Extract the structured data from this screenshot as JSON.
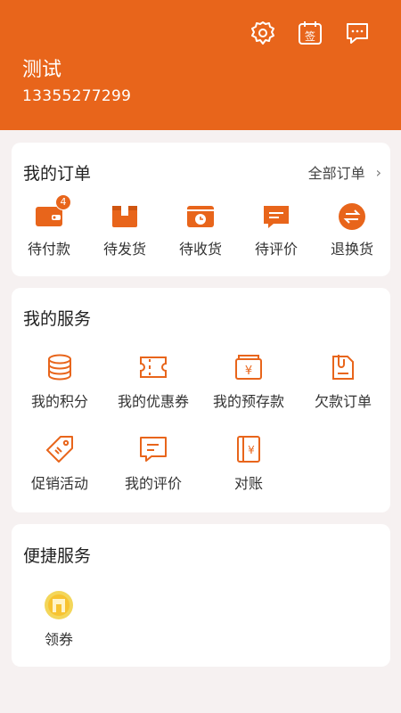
{
  "header": {
    "user_name": "测试",
    "phone": "13355277299",
    "icons": [
      "gear-icon",
      "sign-in-icon",
      "message-icon"
    ],
    "accent": "#e8651b"
  },
  "orders": {
    "title": "我的订单",
    "all_label": "全部订单",
    "items": [
      {
        "label": "待付款",
        "icon": "wallet-icon",
        "badge": "4"
      },
      {
        "label": "待发货",
        "icon": "box-icon"
      },
      {
        "label": "待收货",
        "icon": "clock-box-icon"
      },
      {
        "label": "待评价",
        "icon": "comment-icon"
      },
      {
        "label": "退换货",
        "icon": "exchange-icon"
      }
    ]
  },
  "services": {
    "title": "我的服务",
    "items": [
      {
        "label": "我的积分",
        "icon": "coins-icon"
      },
      {
        "label": "我的优惠券",
        "icon": "coupon-icon"
      },
      {
        "label": "我的预存款",
        "icon": "deposit-icon"
      },
      {
        "label": "欠款订单",
        "icon": "debt-icon"
      },
      {
        "label": "促销活动",
        "icon": "tag-icon"
      },
      {
        "label": "我的评价",
        "icon": "review-icon"
      },
      {
        "label": "对账",
        "icon": "ledger-icon"
      }
    ]
  },
  "quick": {
    "title": "便捷服务",
    "items": [
      {
        "label": "领券",
        "icon": "coupon-claim-icon"
      }
    ]
  }
}
